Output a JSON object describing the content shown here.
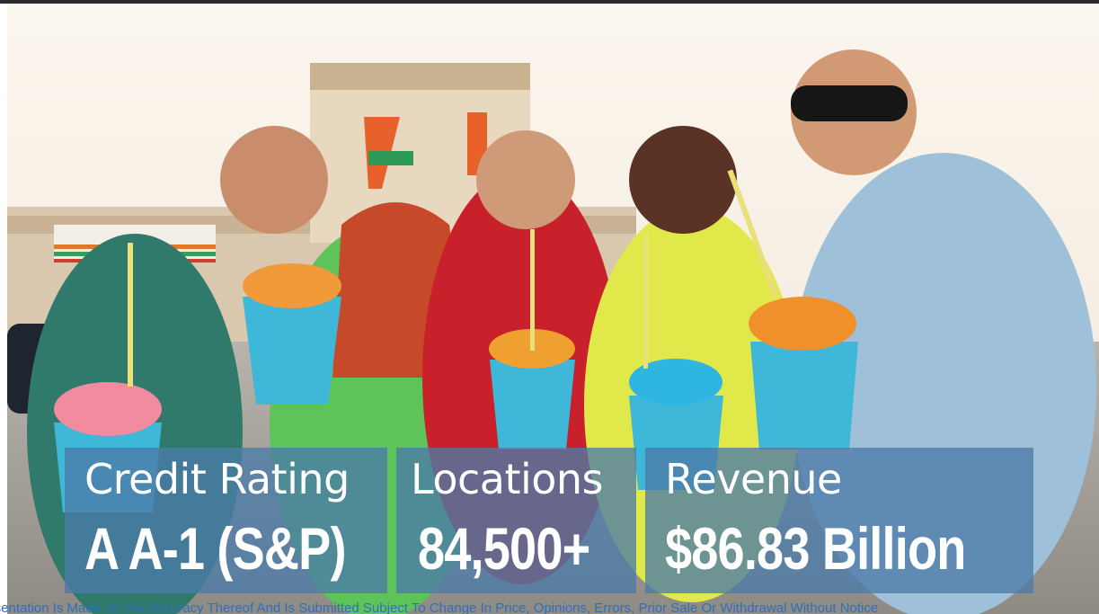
{
  "stats": {
    "credit_rating": {
      "label": "Credit Rating",
      "value": "A A-1 (S&P)"
    },
    "locations": {
      "label": "Locations",
      "value": "84,500+"
    },
    "revenue": {
      "label": "Revenue",
      "value": "$86.83 Billion"
    }
  },
  "footer": {
    "disclaimer": "presentation Is Made To The Accuracy Thereof And Is Submitted Subject To Change In Price, Opinions, Errors, Prior Sale Or Withdrawal Without Notice"
  },
  "photo": {
    "subject": "storefront-photo"
  },
  "colors": {
    "card_bg": "#4c7ba8",
    "card_text": "#ffffff",
    "disclaimer_text": "#2f6fc0"
  }
}
